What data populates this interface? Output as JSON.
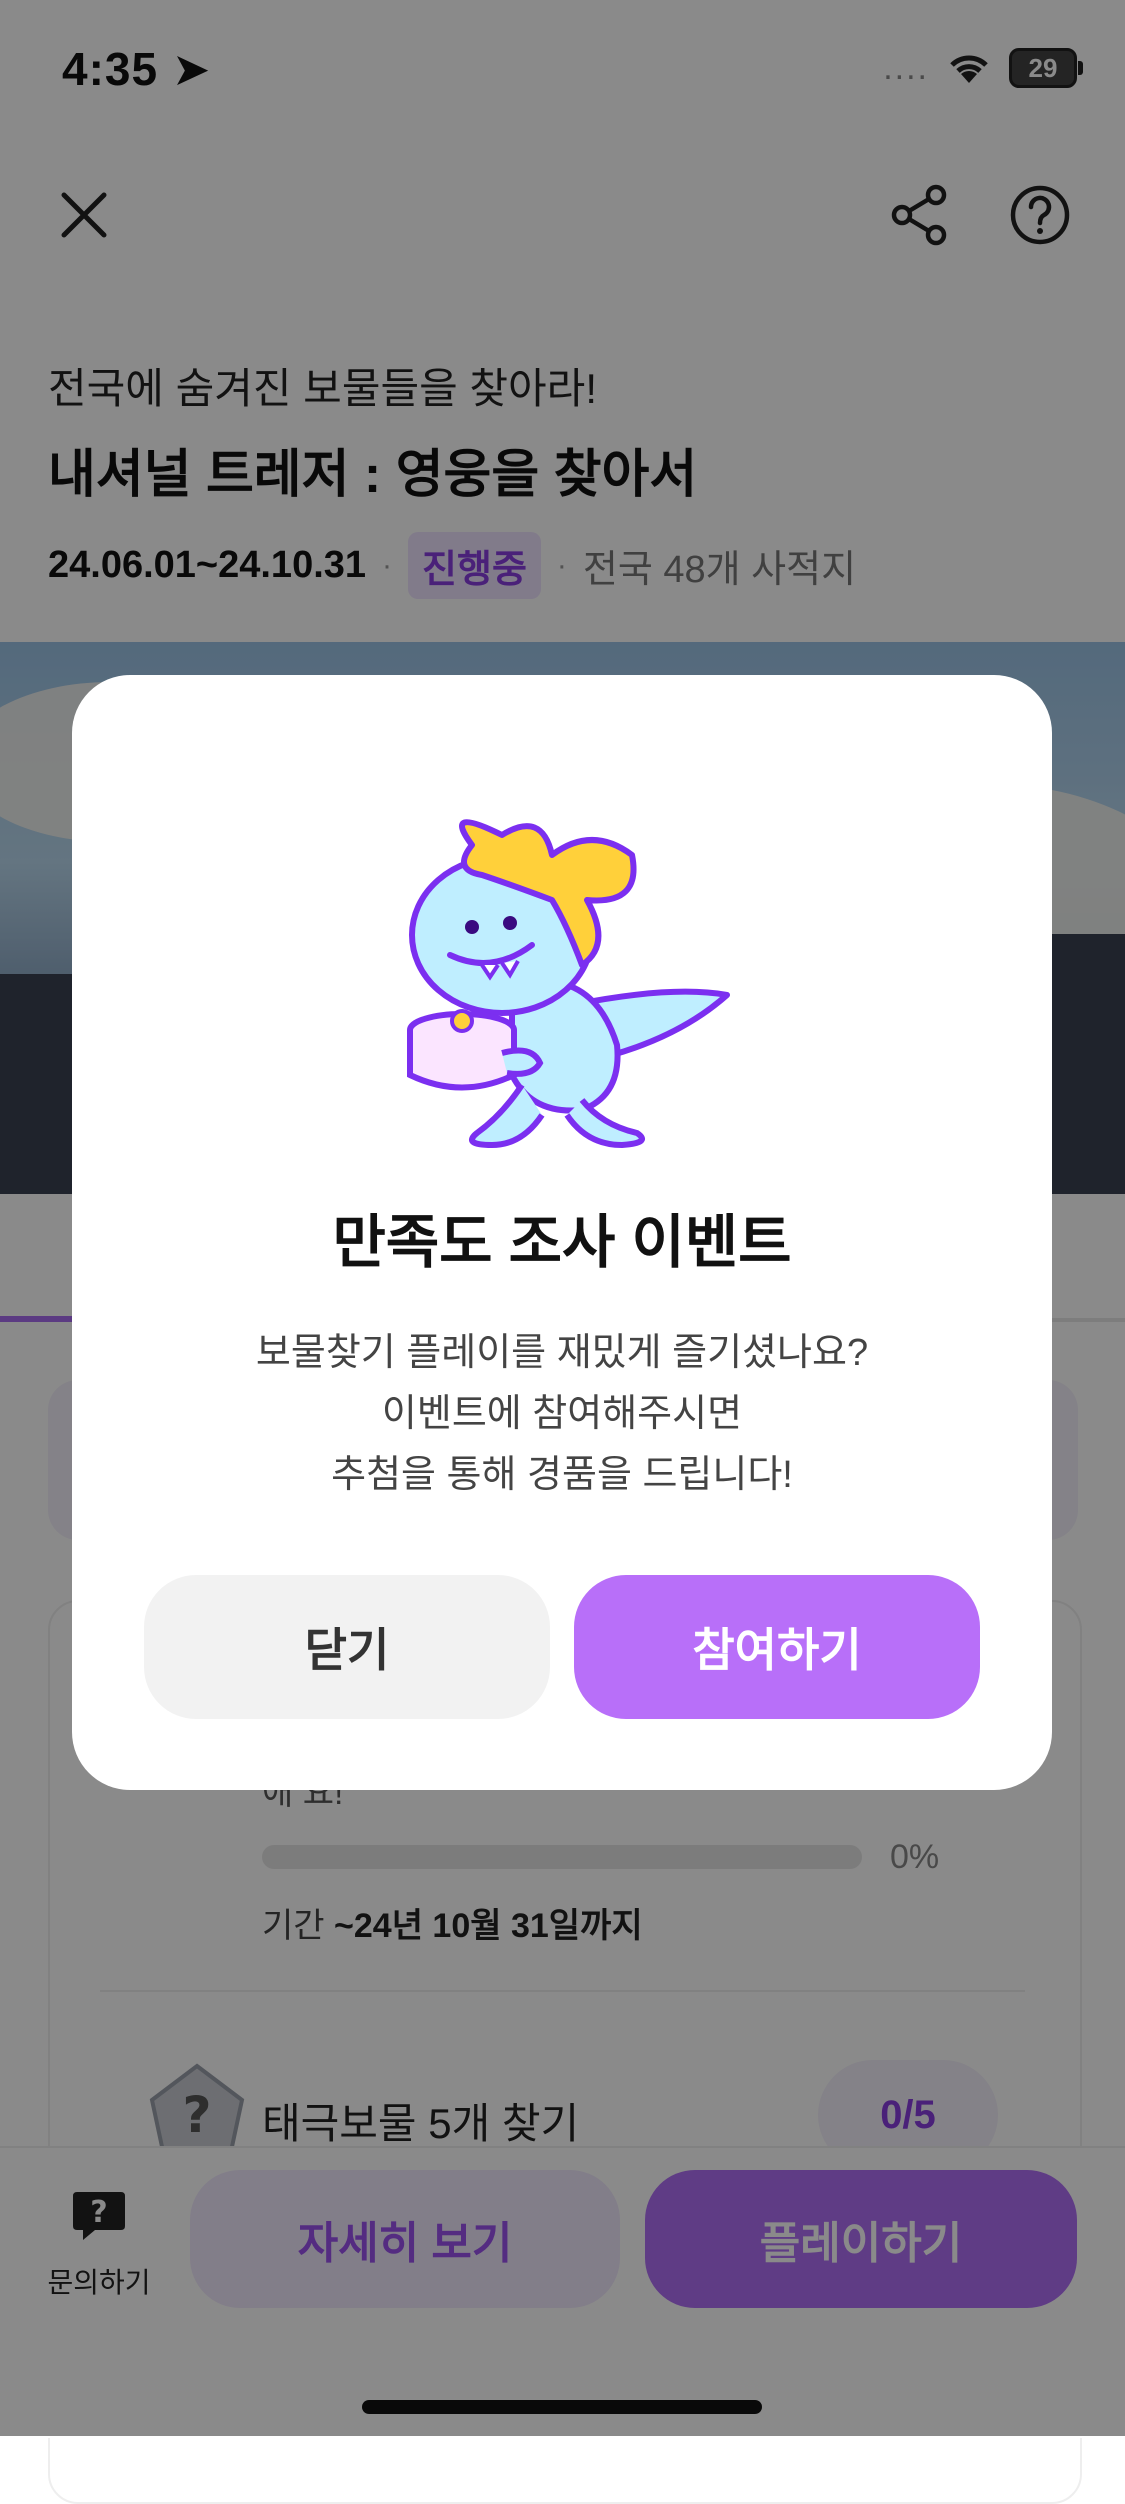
{
  "status_bar": {
    "time": "4:35",
    "signal_dots": "....",
    "battery": "29"
  },
  "header": {
    "close_icon": "close-icon",
    "share_icon": "share-icon",
    "help_icon": "help-icon"
  },
  "event": {
    "subtitle": "전국에 숨겨진 보물들을 찾아라!",
    "title": "내셔널 트레저 : 영웅을 찾아서",
    "period": "24.06.01~24.10.31",
    "status_badge": "진행중",
    "location": "전국 48개 사적지"
  },
  "mission": {
    "partial_text": "애 요!",
    "progress": 0,
    "progress_label": "0%",
    "period_prefix": "기간 ",
    "period_value": "~24년 10월 31일까지",
    "second_title": "태극보물 5개 찾기",
    "second_count": "0/5"
  },
  "bottom_bar": {
    "inquiry_label": "문의하기",
    "detail_label": "자세히 보기",
    "play_label": "플레이하기"
  },
  "modal": {
    "title": "만족도 조사 이벤트",
    "body_lines": [
      "보물찾기 플레이를 재밌게 즐기셨나요?",
      "이벤트에 참여해주시면",
      "추첨을 통해 경품을 드립니다!"
    ],
    "close_label": "닫기",
    "join_label": "참여하기"
  },
  "colors": {
    "accent": "#b86ff9",
    "accent_light": "#f1e9fd",
    "mascot_outline": "#7b2ff0",
    "mascot_body": "#bfeeff",
    "ribbon": "#ffd03a"
  }
}
